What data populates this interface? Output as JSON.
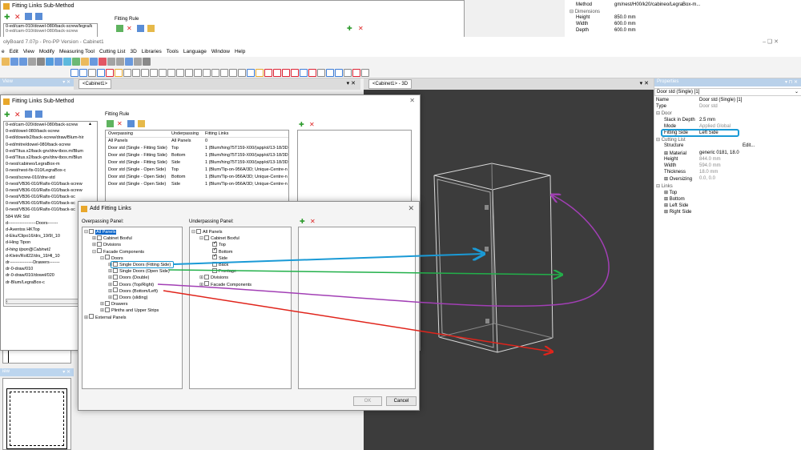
{
  "top_window": {
    "title": "Fitting Links Sub-Method",
    "list": [
      "0-ed/cam-010/dowel-080/back-screw/legra/k",
      "0-ed/cam-010/dowel-080/back-screw"
    ],
    "fitting_rule": "Fitting Rule"
  },
  "top_props": [
    {
      "k": "Method",
      "v": "gm/nest/H00/k20/cabineo/LegraBox-m..."
    },
    {
      "k": "⊟ Dimensions",
      "v": ""
    },
    {
      "k": "Height",
      "v": "850.0 mm"
    },
    {
      "k": "Width",
      "v": "600.0 mm"
    },
    {
      "k": "Depth",
      "v": "600.0 mm"
    }
  ],
  "app_title": "olyBoard 7.07p - Pro-PP Version - Cabinet1",
  "window_controls": "–    ❑    ✕",
  "menu": [
    "e",
    "Edit",
    "View",
    "Modify",
    "Measuring Tool",
    "Cutting List",
    "3D",
    "Libraries",
    "Tools",
    "Language",
    "Window",
    "Help"
  ],
  "left_pane1": {
    "title": "View",
    "ctrls": "▾ ✕"
  },
  "left_pane2": {
    "title": "iew",
    "ctrls": "▾ ✕"
  },
  "doc1_tab": "<Cabinet1>",
  "doc2_tab": "<Cabinet1> - 3D",
  "properties": {
    "title": "Properties",
    "selector": "Door std (Single) [1]",
    "rows": [
      {
        "k": "Name",
        "v": "Door std (Single) [1]",
        "ind": 0
      },
      {
        "k": "Type",
        "v": "Door std",
        "ind": 0
      },
      {
        "k": "⊟ Door",
        "v": "",
        "ind": 0
      },
      {
        "k": "Slack in Depth",
        "v": "2.5 mm",
        "ind": 1
      },
      {
        "k": "Mode",
        "v": "Applied Global",
        "ind": 1
      },
      {
        "k": "Fitting Side",
        "v": "Left Side",
        "ind": 1
      },
      {
        "k": "⊟ Cutting List",
        "v": "",
        "ind": 0
      },
      {
        "k": "Structure",
        "v": "Edit...",
        "ind": 1
      },
      {
        "k": "⊞ Material",
        "v": "generic 0181, 18.0",
        "ind": 1
      },
      {
        "k": "Height",
        "v": "844.0 mm",
        "ind": 1
      },
      {
        "k": "Width",
        "v": "594.0 mm",
        "ind": 1
      },
      {
        "k": "Thickness",
        "v": "18.0 mm",
        "ind": 1
      },
      {
        "k": "⊞ Oversizing",
        "v": "0.0, 0.0",
        "ind": 1
      },
      {
        "k": "⊟ Links",
        "v": "",
        "ind": 0
      },
      {
        "k": "⊞ Top",
        "v": "",
        "ind": 1
      },
      {
        "k": "⊞ Bottom",
        "v": "",
        "ind": 1
      },
      {
        "k": "⊞ Left Side",
        "v": "",
        "ind": 1
      },
      {
        "k": "⊞ Right Side",
        "v": "",
        "ind": 1
      }
    ]
  },
  "flsm": {
    "title": "Fitting Links Sub-Method",
    "close": "✕",
    "fitting_rule_label": "Fitting Rule",
    "list": [
      "0-ed/cam-020/dowel-080/back-screw",
      "0-ed/dowel-080/back-screw",
      "0-ed/dowelx2/back-screw/draw/Blum-hir",
      "0-ed/mitre/dowel-080/back-screw",
      "0-ed/Titus.x2/back-grv/drw-tbox.m/Blum",
      "0-ed/Titus.x2/back-grv/drw-tbox.m/Blun",
      "0-nest/cabineo/LegraBox-m",
      "0-nest/nest-fix-010/LegraBox-c",
      "0-nest/screw-010/drw-std",
      "0-nest/VB36-010/Rafix-010/back-screw",
      "0-nest/VB36-010/Rafix-010/back-screw",
      "0-nest/VB36-010/Rafix-010/back-sc",
      "0-nest/VB36-010/Rafix-010/back-sc",
      "0-nest/VB36-010/Rafix-010/back-sc",
      "584 WR Std",
      "d-------------------Doors-------",
      "d-Aventos HKTop",
      "d-Eku/Clipo16/drs_19/9l_10",
      "d-Hing Tipon",
      "d-hing tipon@Cabinet1",
      "d-Klein/Roll22/drs_19/4l_10",
      "dr----------------Drawers-------",
      "dr-0-draw/010",
      "dr-0-draw/010/dowel/020",
      "dr-Blum/LegraBox-c"
    ],
    "table": {
      "headers": [
        "Overpassing",
        "Underpassing",
        "Fitting Links"
      ],
      "rows": [
        [
          "All Panels",
          "All Panels",
          "0"
        ],
        [
          "Door std (Single - Fitting Side)",
          "Top",
          "1 (Blum/hing75T159-X00/(app/ol/13-18/3D"
        ],
        [
          "Door std (Single - Fitting Side)",
          "Bottom",
          "1 (Blum/hing75T159-X00/(app/ol/13-18/3D"
        ],
        [
          "Door std (Single - Fitting Side)",
          "Side",
          "1 (Blum/hing75T159-X00/(app/ol/13-18/3D"
        ],
        [
          "Door std (Single - Open Side)",
          "Top",
          "1 (Blum/Tip-on-956A/3D; Unique-Centre-n"
        ],
        [
          "Door std (Single - Open Side)",
          "Bottom",
          "1 (Blum/Tip-on-956A/3D; Unique-Centre-n"
        ],
        [
          "Door std (Single - Open Side)",
          "Side",
          "1 (Blum/Tip-on-956A/3D; Unique-Centre-n"
        ]
      ]
    }
  },
  "afl": {
    "title": "Add Fitting Links",
    "close": "✕",
    "over_label": "Overpassing Panel:",
    "under_label": "Underpassing Panel:",
    "ok": "OK",
    "cancel": "Cancel",
    "over_tree": [
      {
        "t": "All Panels",
        "lvl": 0,
        "ex": "⊟",
        "cb": false,
        "sel": true
      },
      {
        "t": "Cabinet Boxful",
        "lvl": 1,
        "ex": "⊞",
        "cb": false
      },
      {
        "t": "Divisions",
        "lvl": 1,
        "ex": "⊞",
        "cb": false
      },
      {
        "t": "Facade Components",
        "lvl": 1,
        "ex": "⊟",
        "cb": false
      },
      {
        "t": "Doors",
        "lvl": 2,
        "ex": "⊟",
        "cb": false
      },
      {
        "t": "Single Doors (Fitting Side)",
        "lvl": 3,
        "ex": "⊞",
        "cb": false,
        "hl": true
      },
      {
        "t": "Single Doors (Open Side)",
        "lvl": 3,
        "ex": "⊞",
        "cb": false
      },
      {
        "t": "Doors (Double)",
        "lvl": 3,
        "ex": "⊞",
        "cb": false
      },
      {
        "t": "Doors (Top/Right)",
        "lvl": 3,
        "ex": "⊞",
        "cb": false
      },
      {
        "t": "Doors (Bottom/Left)",
        "lvl": 3,
        "ex": "⊞",
        "cb": false
      },
      {
        "t": "Doors (sliding)",
        "lvl": 3,
        "ex": "⊞",
        "cb": false
      },
      {
        "t": "Drawers",
        "lvl": 2,
        "ex": "⊞",
        "cb": false
      },
      {
        "t": "Plinths and Upper Strips",
        "lvl": 2,
        "ex": "⊞",
        "cb": false
      },
      {
        "t": "External Panels",
        "lvl": 0,
        "ex": "⊞",
        "cb": false
      }
    ],
    "under_tree": [
      {
        "t": "All Panels",
        "lvl": 0,
        "ex": "⊟",
        "cb": false
      },
      {
        "t": "Cabinet Boxful",
        "lvl": 1,
        "ex": "⊟",
        "cb": false
      },
      {
        "t": "Top",
        "lvl": 2,
        "ex": "",
        "cb": true
      },
      {
        "t": "Bottom",
        "lvl": 2,
        "ex": "",
        "cb": true
      },
      {
        "t": "Side",
        "lvl": 2,
        "ex": "",
        "cb": true
      },
      {
        "t": "Back",
        "lvl": 2,
        "ex": "",
        "cb": false
      },
      {
        "t": "Frontage",
        "lvl": 2,
        "ex": "",
        "cb": false
      },
      {
        "t": "Divisions",
        "lvl": 1,
        "ex": "⊞",
        "cb": false
      },
      {
        "t": "Facade Components",
        "lvl": 1,
        "ex": "⊞",
        "cb": false
      }
    ]
  },
  "colors": {
    "blue_arrow": "#1a9ad6",
    "green_arrow": "#22b04a",
    "purple_arrow": "#a23fb5",
    "red_arrow": "#e0241b",
    "selection": "#0a64c8"
  }
}
